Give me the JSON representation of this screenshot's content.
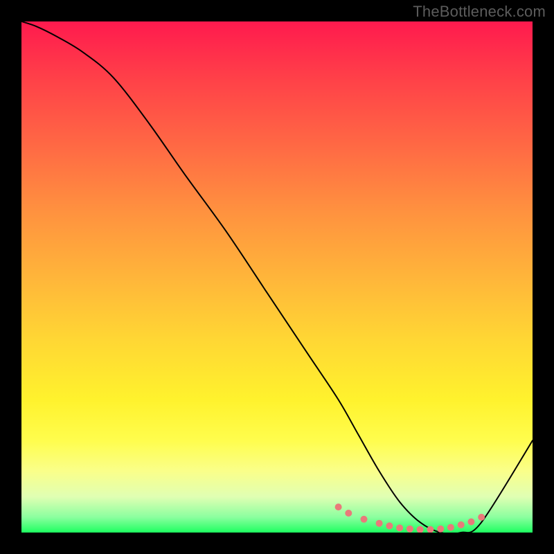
{
  "watermark": "TheBottleneck.com",
  "chart_data": {
    "type": "line",
    "title": "",
    "xlabel": "",
    "ylabel": "",
    "xlim": [
      0,
      100
    ],
    "ylim": [
      0,
      100
    ],
    "series": [
      {
        "name": "curve",
        "x": [
          0,
          3,
          7,
          12,
          18,
          25,
          32,
          40,
          48,
          56,
          62,
          66,
          70,
          74,
          78,
          82,
          86,
          90,
          100
        ],
        "y": [
          100,
          99,
          97,
          94,
          89,
          80,
          70,
          59,
          47,
          35,
          26,
          19,
          12,
          6,
          2,
          0,
          0,
          2,
          18
        ]
      }
    ],
    "markers": {
      "name": "dots",
      "color": "#e97a7a",
      "x": [
        62,
        64,
        67,
        70,
        72,
        74,
        76,
        78,
        80,
        82,
        84,
        86,
        88,
        90
      ],
      "y": [
        5,
        3.8,
        2.6,
        1.8,
        1.3,
        0.9,
        0.7,
        0.6,
        0.6,
        0.7,
        1.0,
        1.5,
        2.1,
        3.0
      ]
    }
  }
}
